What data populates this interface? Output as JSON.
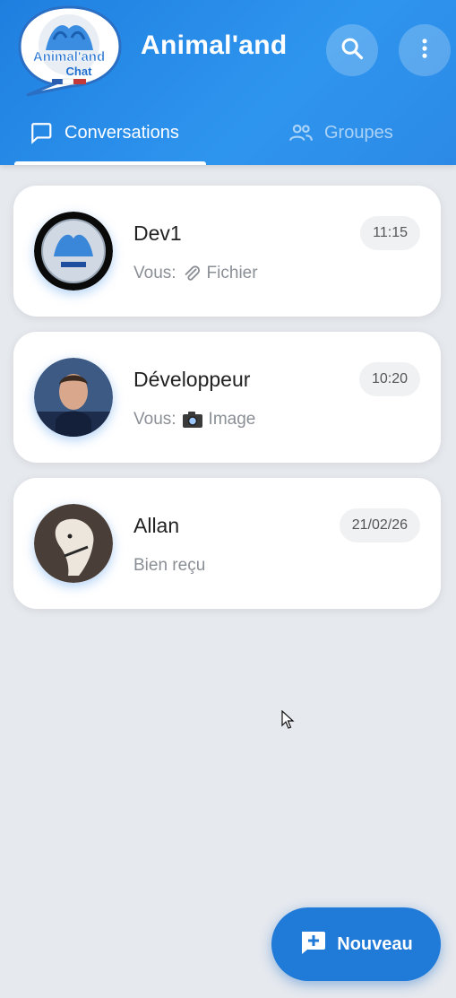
{
  "app": {
    "title": "Animal'and",
    "logo_text_line1": "Animal'and",
    "logo_text_line2": "Chat"
  },
  "header": {
    "search_icon": "search-icon",
    "menu_icon": "more-vert-icon"
  },
  "tabs": [
    {
      "label": "Conversations",
      "icon": "chat-bubble-icon",
      "active": true
    },
    {
      "label": "Groupes",
      "icon": "people-icon",
      "active": false
    }
  ],
  "conversations": [
    {
      "name": "Dev1",
      "prefix": "Vous:",
      "icon": "paperclip-icon",
      "preview": "Fichier",
      "time": "11:15"
    },
    {
      "name": "Développeur",
      "prefix": "Vous:",
      "icon": "camera-icon",
      "preview": "Image",
      "time": "10:20"
    },
    {
      "name": "Allan",
      "prefix": "",
      "icon": "",
      "preview": "Bien reçu",
      "time": "21/02/26"
    }
  ],
  "fab": {
    "label": "Nouveau",
    "icon": "add-box-icon"
  },
  "colors": {
    "primary": "#1f7fe0",
    "background": "#e6e9ee",
    "card": "#ffffff",
    "muted_text": "#8a8f96"
  }
}
